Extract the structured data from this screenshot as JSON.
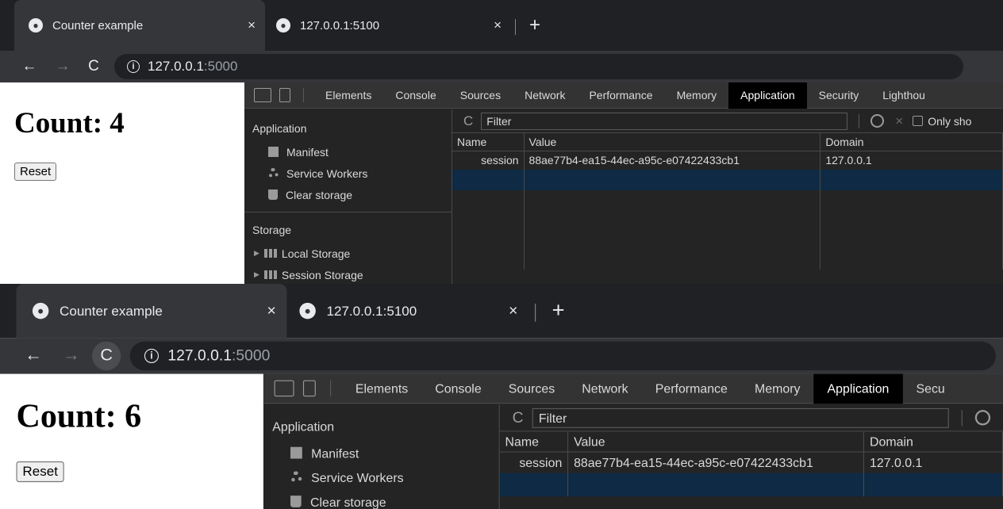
{
  "screens": [
    {
      "tabs": [
        {
          "title": "Counter example",
          "close": "×"
        },
        {
          "title": "127.0.0.1:5100",
          "close": "×"
        }
      ],
      "new_tab": "+",
      "nav": {
        "back": "←",
        "forward": "→",
        "reload": "C"
      },
      "address": {
        "info": "i",
        "host": "127.0.0.1",
        "port": ":5000"
      },
      "page": {
        "heading": "Count: 4",
        "reset_label": "Reset"
      },
      "devtools": {
        "tabs": [
          "Elements",
          "Console",
          "Sources",
          "Network",
          "Performance",
          "Memory",
          "Application",
          "Security",
          "Lighthou"
        ],
        "active_tab": "Application",
        "sidebar": {
          "application_header": "Application",
          "application_items": [
            "Manifest",
            "Service Workers",
            "Clear storage"
          ],
          "storage_header": "Storage",
          "storage_items": [
            "Local Storage",
            "Session Storage"
          ]
        },
        "filter": {
          "refresh": "C",
          "placeholder": "Filter",
          "only_show": "Only sho"
        },
        "table": {
          "columns": [
            "Name",
            "Value",
            "Domain"
          ],
          "rows": [
            {
              "name": "session",
              "value": "88ae77b4-ea15-44ec-a95c-e07422433cb1",
              "domain": "127.0.0.1"
            }
          ]
        }
      }
    },
    {
      "tabs": [
        {
          "title": "Counter example",
          "close": "×"
        },
        {
          "title": "127.0.0.1:5100",
          "close": "×"
        }
      ],
      "new_tab": "+",
      "nav": {
        "back": "←",
        "forward": "→",
        "reload": "C"
      },
      "address": {
        "info": "i",
        "host": "127.0.0.1",
        "port": ":5000"
      },
      "page": {
        "heading": "Count: 6",
        "reset_label": "Reset"
      },
      "devtools": {
        "tabs": [
          "Elements",
          "Console",
          "Sources",
          "Network",
          "Performance",
          "Memory",
          "Application",
          "Secu"
        ],
        "active_tab": "Application",
        "sidebar": {
          "application_header": "Application",
          "application_items": [
            "Manifest",
            "Service Workers",
            "Clear storage"
          ]
        },
        "filter": {
          "refresh": "C",
          "placeholder": "Filter"
        },
        "table": {
          "columns": [
            "Name",
            "Value",
            "Domain"
          ],
          "rows": [
            {
              "name": "session",
              "value": "88ae77b4-ea15-44ec-a95c-e07422433cb1",
              "domain": "127.0.0.1"
            }
          ]
        }
      }
    }
  ]
}
